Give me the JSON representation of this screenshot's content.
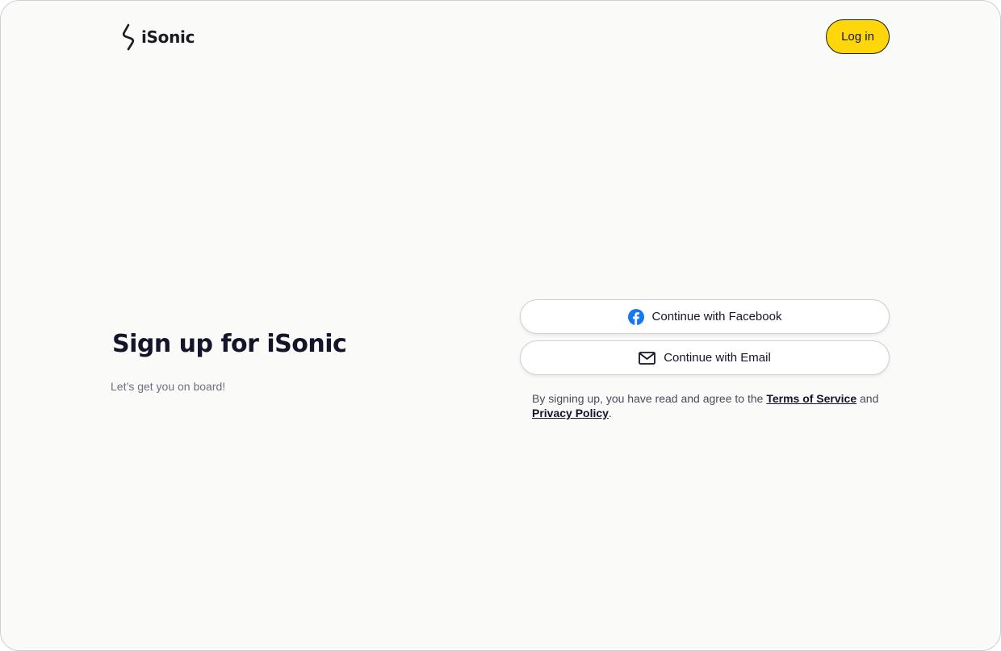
{
  "header": {
    "brand": "iSonic",
    "login_label": "Log in"
  },
  "hero": {
    "title": "Sign up for iSonic",
    "subtitle": "Let’s get you on board!"
  },
  "auth": {
    "facebook_label": "Continue with Facebook",
    "email_label": "Continue with Email"
  },
  "legal": {
    "prefix": "By signing up, you have read and agree to the ",
    "terms_label": "Terms of Service",
    "middle": " and ",
    "privacy_label": "Privacy Policy",
    "suffix": "."
  },
  "icons": {
    "logo": "isonic-logo-icon",
    "facebook": "facebook-icon",
    "email": "mail-icon"
  },
  "colors": {
    "accent": "#ffd60a",
    "facebook": "#1877f2",
    "text_dark": "#14142b",
    "background": "#fafaf8"
  }
}
